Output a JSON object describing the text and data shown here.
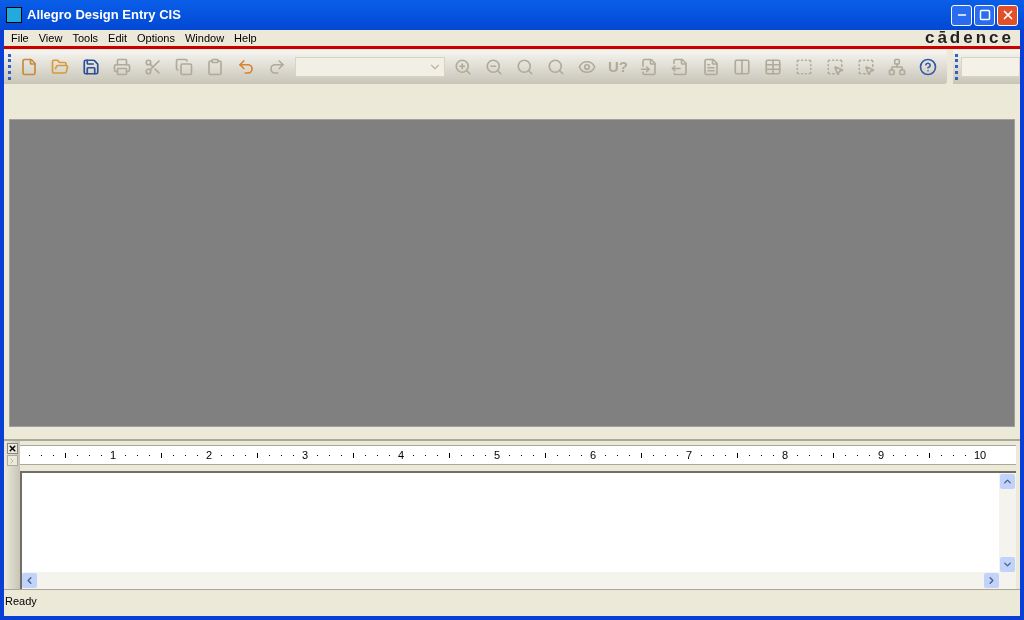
{
  "window": {
    "title": "Allegro Design Entry CIS"
  },
  "menu": [
    "File",
    "View",
    "Tools",
    "Edit",
    "Options",
    "Window",
    "Help"
  ],
  "brand": "cādence",
  "toolbar": [
    {
      "kind": "new",
      "disabled": false
    },
    {
      "kind": "open",
      "disabled": false
    },
    {
      "kind": "save",
      "disabled": false
    },
    {
      "kind": "print",
      "disabled": true
    },
    {
      "kind": "cut",
      "disabled": true
    },
    {
      "kind": "copy",
      "disabled": true
    },
    {
      "kind": "paste",
      "disabled": true
    },
    {
      "kind": "undo",
      "disabled": false
    },
    {
      "kind": "redo",
      "disabled": true
    },
    {
      "kind": "combo",
      "disabled": true
    },
    {
      "kind": "zoomin",
      "disabled": true
    },
    {
      "kind": "zoomout",
      "disabled": true
    },
    {
      "kind": "zoomarea",
      "disabled": true
    },
    {
      "kind": "zoomall",
      "disabled": true
    },
    {
      "kind": "eye",
      "disabled": true
    },
    {
      "kind": "text",
      "label": "U?",
      "disabled": true
    },
    {
      "kind": "annotate",
      "disabled": true
    },
    {
      "kind": "docarrow",
      "disabled": true
    },
    {
      "kind": "doc",
      "disabled": true
    },
    {
      "kind": "parts",
      "disabled": true
    },
    {
      "kind": "table",
      "disabled": true
    },
    {
      "kind": "area",
      "disabled": true
    },
    {
      "kind": "areapointer",
      "disabled": true
    },
    {
      "kind": "boxpointer",
      "disabled": true
    },
    {
      "kind": "tree",
      "disabled": true
    },
    {
      "kind": "help",
      "disabled": false
    }
  ],
  "ruler": [
    "1",
    "2",
    "3",
    "4",
    "5",
    "6",
    "7",
    "8",
    "9",
    "10"
  ],
  "status_bar": {
    "text": "Ready"
  }
}
